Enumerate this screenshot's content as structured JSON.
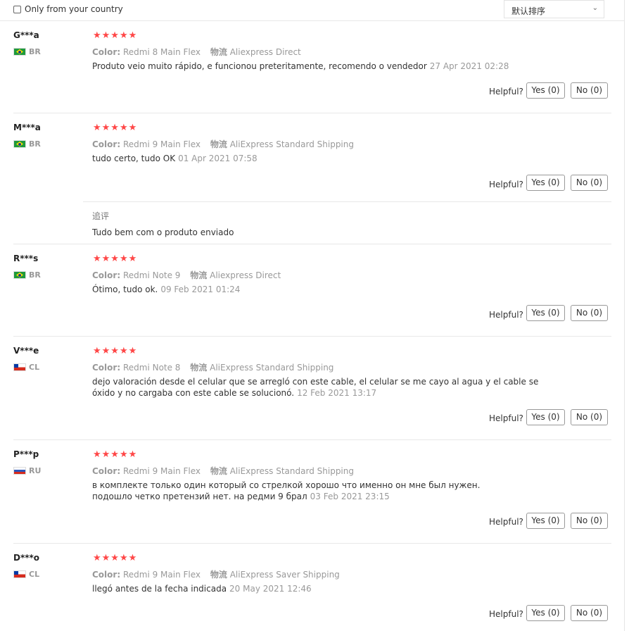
{
  "filter": {
    "label": "Only from your country",
    "checked": false
  },
  "sort": {
    "selected": "默认排序"
  },
  "labels": {
    "color": "Color:",
    "logistics": "物流",
    "helpful": "Helpful?",
    "followup": "追评"
  },
  "star_color": "#ff4747",
  "reviews": [
    {
      "name": "G***a",
      "country": "BR",
      "flag": "brazil-flag",
      "stars": 5,
      "stars_text": "★★★★★",
      "color": "Redmi 8 Main Flex",
      "shipping": "Aliexpress Direct",
      "text": "Produto veio muito rápido, e funcionou preteritamente, recomendo o vendedor",
      "date": "27 Apr 2021 02:28",
      "yes": "Yes (0)",
      "no": "No (0)"
    },
    {
      "name": "M***a",
      "country": "BR",
      "flag": "brazil-flag",
      "stars": 5,
      "stars_text": "★★★★★",
      "color": "Redmi 9 Main Flex",
      "shipping": "AliExpress Standard Shipping",
      "text": "tudo certo, tudo OK",
      "date": "01 Apr 2021 07:58",
      "yes": "Yes (0)",
      "no": "No (0)",
      "followup": "Tudo bem com o produto enviado"
    },
    {
      "name": "R***s",
      "country": "BR",
      "flag": "brazil-flag",
      "stars": 5,
      "stars_text": "★★★★★",
      "color": "Redmi Note 9",
      "shipping": "Aliexpress Direct",
      "text": "Ótimo, tudo ok.",
      "date": "09 Feb 2021 01:24",
      "yes": "Yes (0)",
      "no": "No (0)"
    },
    {
      "name": "V***e",
      "country": "CL",
      "flag": "chile-flag",
      "stars": 5,
      "stars_text": "★★★★★",
      "color": "Redmi Note 8",
      "shipping": "AliExpress Standard Shipping",
      "text": "dejo valoración desde el celular que se arregló con este cable, el celular se me cayo al agua y el cable se óxido y no cargaba con este cable se solucionó.",
      "date": "12 Feb 2021 13:17",
      "yes": "Yes (0)",
      "no": "No (0)"
    },
    {
      "name": "P***p",
      "country": "RU",
      "flag": "russia-flag",
      "stars": 5,
      "stars_text": "★★★★★",
      "color": "Redmi 9 Main Flex",
      "shipping": "AliExpress Standard Shipping",
      "text": "в комплекте только один который со стрелкой хорошо что именно он мне был нужен. подошло четко претензий нет. на редми 9 брал",
      "date": "03 Feb 2021 23:15",
      "yes": "Yes (0)",
      "no": "No (0)"
    },
    {
      "name": "D***o",
      "country": "CL",
      "flag": "chile-flag",
      "stars": 5,
      "stars_text": "★★★★★",
      "color": "Redmi 9 Main Flex",
      "shipping": "AliExpress Saver Shipping",
      "text": "llegó antes de la fecha indicada",
      "date": "20 May 2021 12:46",
      "yes": "Yes (0)",
      "no": "No (0)"
    }
  ]
}
